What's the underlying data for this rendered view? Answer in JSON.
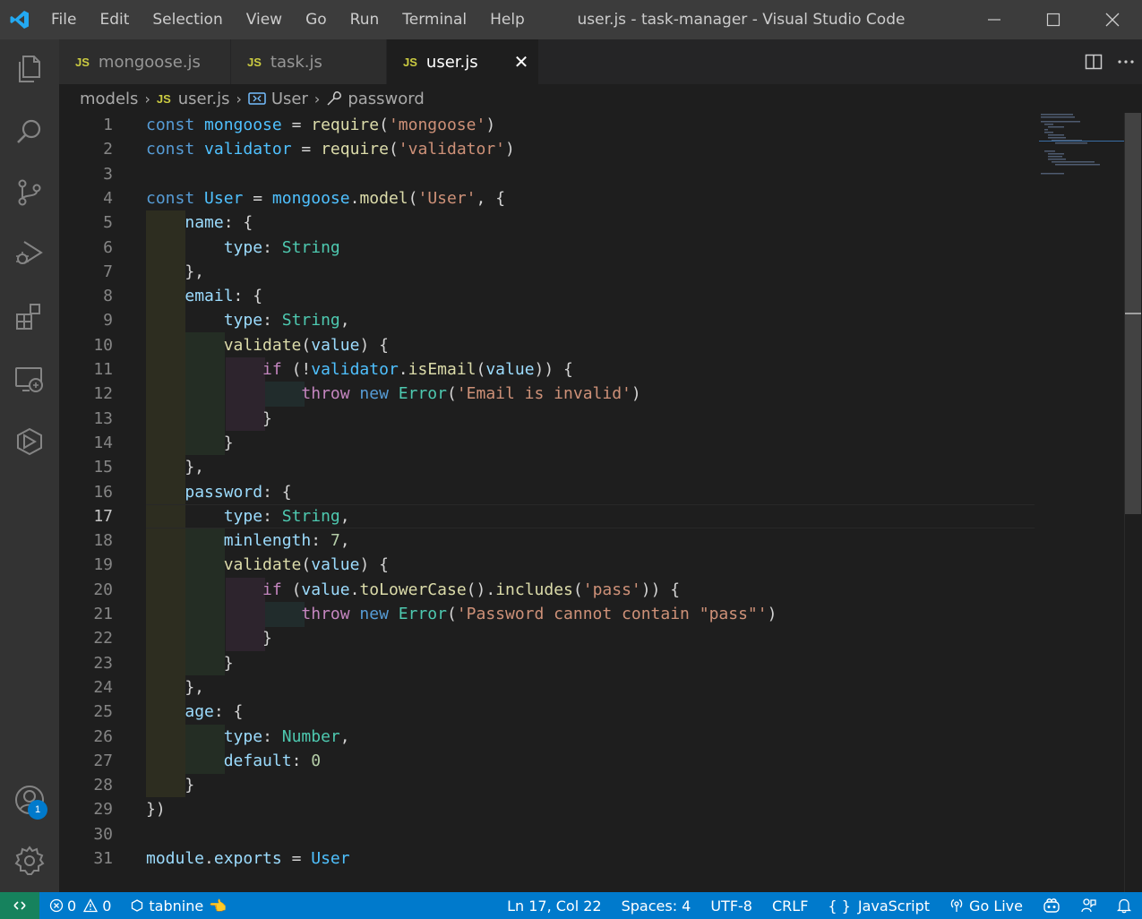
{
  "window": {
    "title": "user.js - task-manager - Visual Studio Code"
  },
  "menu": [
    "File",
    "Edit",
    "Selection",
    "View",
    "Go",
    "Run",
    "Terminal",
    "Help"
  ],
  "tabs": [
    {
      "badge": "JS",
      "label": "mongoose.js",
      "active": false
    },
    {
      "badge": "JS",
      "label": "task.js",
      "active": false
    },
    {
      "badge": "JS",
      "label": "user.js",
      "active": true
    }
  ],
  "breadcrumb": {
    "folder": "models",
    "file_badge": "JS",
    "file": "user.js",
    "symbol": "User",
    "property": "password"
  },
  "activity": {
    "icons": [
      "explorer-icon",
      "search-icon",
      "source-control-icon",
      "run-debug-icon",
      "extensions-icon",
      "remote-explorer-icon",
      "liveshare-icon",
      "accounts-icon",
      "settings-gear-icon"
    ],
    "accounts_badge": "1"
  },
  "editor": {
    "current_line": 17,
    "lines": [
      {
        "n": "1"
      },
      {
        "n": "2"
      },
      {
        "n": "3"
      },
      {
        "n": "4"
      },
      {
        "n": "5"
      },
      {
        "n": "6"
      },
      {
        "n": "7"
      },
      {
        "n": "8"
      },
      {
        "n": "9"
      },
      {
        "n": "10"
      },
      {
        "n": "11"
      },
      {
        "n": "12"
      },
      {
        "n": "13"
      },
      {
        "n": "14"
      },
      {
        "n": "15"
      },
      {
        "n": "16"
      },
      {
        "n": "17"
      },
      {
        "n": "18"
      },
      {
        "n": "19"
      },
      {
        "n": "20"
      },
      {
        "n": "21"
      },
      {
        "n": "22"
      },
      {
        "n": "23"
      },
      {
        "n": "24"
      },
      {
        "n": "25"
      },
      {
        "n": "26"
      },
      {
        "n": "27"
      },
      {
        "n": "28"
      },
      {
        "n": "29"
      },
      {
        "n": "30"
      },
      {
        "n": "31"
      }
    ],
    "code": {
      "l1": [
        [
          "kw",
          "const"
        ],
        [
          "pun",
          " "
        ],
        [
          "const",
          "mongoose"
        ],
        [
          "pun",
          " = "
        ],
        [
          "fn",
          "require"
        ],
        [
          "pun",
          "("
        ],
        [
          "str",
          "'mongoose'"
        ],
        [
          "pun",
          ")"
        ]
      ],
      "l2": [
        [
          "kw",
          "const"
        ],
        [
          "pun",
          " "
        ],
        [
          "const",
          "validator"
        ],
        [
          "pun",
          " = "
        ],
        [
          "fn",
          "require"
        ],
        [
          "pun",
          "("
        ],
        [
          "str",
          "'validator'"
        ],
        [
          "pun",
          ")"
        ]
      ],
      "l3": [],
      "l4": [
        [
          "kw",
          "const"
        ],
        [
          "pun",
          " "
        ],
        [
          "const",
          "User"
        ],
        [
          "pun",
          " = "
        ],
        [
          "const",
          "mongoose"
        ],
        [
          "pun",
          "."
        ],
        [
          "fn",
          "model"
        ],
        [
          "pun",
          "("
        ],
        [
          "str",
          "'User'"
        ],
        [
          "pun",
          ", {"
        ]
      ],
      "l5": [
        [
          "pun",
          "    "
        ],
        [
          "var",
          "name"
        ],
        [
          "pun",
          ": {"
        ]
      ],
      "l6": [
        [
          "pun",
          "        "
        ],
        [
          "var",
          "type"
        ],
        [
          "pun",
          ": "
        ],
        [
          "cls",
          "String"
        ]
      ],
      "l7": [
        [
          "pun",
          "    },"
        ]
      ],
      "l8": [
        [
          "pun",
          "    "
        ],
        [
          "var",
          "email"
        ],
        [
          "pun",
          ": {"
        ]
      ],
      "l9": [
        [
          "pun",
          "        "
        ],
        [
          "var",
          "type"
        ],
        [
          "pun",
          ": "
        ],
        [
          "cls",
          "String"
        ],
        [
          "pun",
          ","
        ]
      ],
      "l10": [
        [
          "pun",
          "        "
        ],
        [
          "fn",
          "validate"
        ],
        [
          "pun",
          "("
        ],
        [
          "var",
          "value"
        ],
        [
          "pun",
          ") {"
        ]
      ],
      "l11": [
        [
          "pun",
          "            "
        ],
        [
          "kw2",
          "if"
        ],
        [
          "pun",
          " (!"
        ],
        [
          "const",
          "validator"
        ],
        [
          "pun",
          "."
        ],
        [
          "fn",
          "isEmail"
        ],
        [
          "pun",
          "("
        ],
        [
          "var",
          "value"
        ],
        [
          "pun",
          ")) {"
        ]
      ],
      "l12": [
        [
          "pun",
          "                "
        ],
        [
          "kw2",
          "throw"
        ],
        [
          "pun",
          " "
        ],
        [
          "kw",
          "new"
        ],
        [
          "pun",
          " "
        ],
        [
          "cls",
          "Error"
        ],
        [
          "pun",
          "("
        ],
        [
          "str",
          "'Email is invalid'"
        ],
        [
          "pun",
          ")"
        ]
      ],
      "l13": [
        [
          "pun",
          "            }"
        ]
      ],
      "l14": [
        [
          "pun",
          "        }"
        ]
      ],
      "l15": [
        [
          "pun",
          "    },"
        ]
      ],
      "l16": [
        [
          "pun",
          "    "
        ],
        [
          "var",
          "password"
        ],
        [
          "pun",
          ": {"
        ]
      ],
      "l17": [
        [
          "pun",
          "        "
        ],
        [
          "var",
          "type"
        ],
        [
          "pun",
          ": "
        ],
        [
          "cls",
          "String"
        ],
        [
          "pun",
          ","
        ]
      ],
      "l18": [
        [
          "pun",
          "        "
        ],
        [
          "var",
          "minlength"
        ],
        [
          "pun",
          ": "
        ],
        [
          "num",
          "7"
        ],
        [
          "pun",
          ","
        ]
      ],
      "l19": [
        [
          "pun",
          "        "
        ],
        [
          "fn",
          "validate"
        ],
        [
          "pun",
          "("
        ],
        [
          "var",
          "value"
        ],
        [
          "pun",
          ") {"
        ]
      ],
      "l20": [
        [
          "pun",
          "            "
        ],
        [
          "kw2",
          "if"
        ],
        [
          "pun",
          " ("
        ],
        [
          "var",
          "value"
        ],
        [
          "pun",
          "."
        ],
        [
          "fn",
          "toLowerCase"
        ],
        [
          "pun",
          "()."
        ],
        [
          "fn",
          "includes"
        ],
        [
          "pun",
          "("
        ],
        [
          "str",
          "'pass'"
        ],
        [
          "pun",
          ")) {"
        ]
      ],
      "l21": [
        [
          "pun",
          "                "
        ],
        [
          "kw2",
          "throw"
        ],
        [
          "pun",
          " "
        ],
        [
          "kw",
          "new"
        ],
        [
          "pun",
          " "
        ],
        [
          "cls",
          "Error"
        ],
        [
          "pun",
          "("
        ],
        [
          "str",
          "'Password cannot contain \"pass\"'"
        ],
        [
          "pun",
          ")"
        ]
      ],
      "l22": [
        [
          "pun",
          "            }"
        ]
      ],
      "l23": [
        [
          "pun",
          "        }"
        ]
      ],
      "l24": [
        [
          "pun",
          "    },"
        ]
      ],
      "l25": [
        [
          "pun",
          "    "
        ],
        [
          "var",
          "age"
        ],
        [
          "pun",
          ": {"
        ]
      ],
      "l26": [
        [
          "pun",
          "        "
        ],
        [
          "var",
          "type"
        ],
        [
          "pun",
          ": "
        ],
        [
          "cls",
          "Number"
        ],
        [
          "pun",
          ","
        ]
      ],
      "l27": [
        [
          "pun",
          "        "
        ],
        [
          "var",
          "default"
        ],
        [
          "pun",
          ": "
        ],
        [
          "num",
          "0"
        ]
      ],
      "l28": [
        [
          "pun",
          "    }"
        ]
      ],
      "l29": [
        [
          "pun",
          "})"
        ]
      ],
      "l30": [],
      "l31": [
        [
          "var",
          "module"
        ],
        [
          "pun",
          "."
        ],
        [
          "var",
          "exports"
        ],
        [
          "pun",
          " = "
        ],
        [
          "const",
          "User"
        ]
      ]
    }
  },
  "statusbar": {
    "errors": "0",
    "warnings": "0",
    "tabnine": "tabnine",
    "position": "Ln 17, Col 22",
    "spaces": "Spaces: 4",
    "encoding": "UTF-8",
    "eol": "CRLF",
    "language": "JavaScript",
    "golive": "Go Live"
  },
  "colors": {
    "titlebar": "#3c3c3c",
    "activitybar": "#333333",
    "editor_bg": "#1e1e1e",
    "statusbar": "#007acc",
    "remote": "#16825d"
  }
}
